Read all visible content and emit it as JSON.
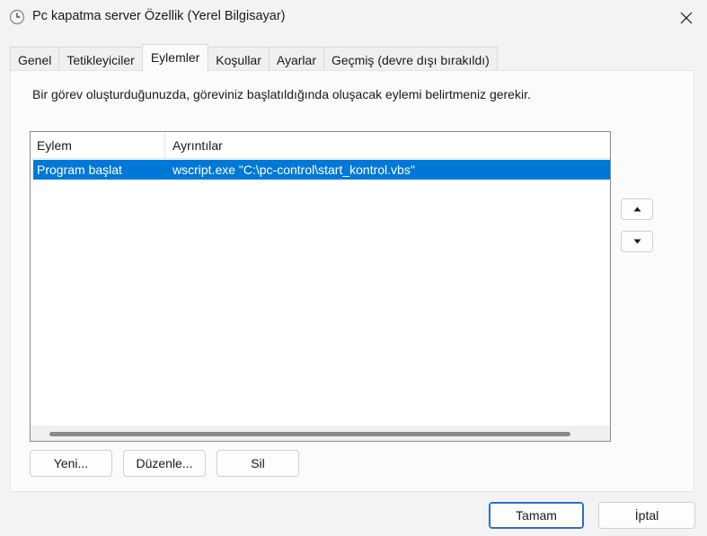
{
  "window": {
    "title": "Pc kapatma server Özellik (Yerel Bilgisayar)",
    "title_icon": "clock-icon",
    "close_icon": "close-icon"
  },
  "tabs": [
    {
      "label": "Genel",
      "active": false
    },
    {
      "label": "Tetikleyiciler",
      "active": false
    },
    {
      "label": "Eylemler",
      "active": true
    },
    {
      "label": "Koşullar",
      "active": false
    },
    {
      "label": "Ayarlar",
      "active": false
    },
    {
      "label": "Geçmiş (devre dışı bırakıldı)",
      "active": false
    }
  ],
  "panel": {
    "instructions": "Bir görev oluşturduğunuzda, göreviniz başlatıldığında oluşacak eylemi belirtmeniz gerekir.",
    "list": {
      "columns": [
        "Eylem",
        "Ayrıntılar"
      ],
      "rows": [
        {
          "action": "Program başlat",
          "details": "wscript.exe \"C:\\pc-control\\start_kontrol.vbs\"",
          "selected": true
        }
      ]
    },
    "move_up_icon": "triangle-up-icon",
    "move_down_icon": "triangle-down-icon",
    "buttons": {
      "new": "Yeni...",
      "edit": "Düzenle...",
      "delete": "Sil"
    }
  },
  "footer": {
    "ok": "Tamam",
    "cancel": "İptal"
  },
  "colors": {
    "selection": "#0078d7",
    "accent_border": "#2b6fc6"
  }
}
